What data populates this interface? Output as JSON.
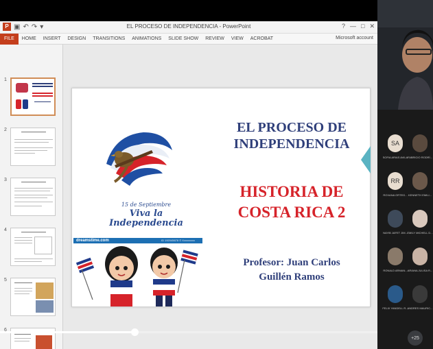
{
  "app": {
    "window_title": "EL PROCESO DE INDEPENDENCIA - PowerPoint",
    "account_label": "Microsoft account",
    "app_badge": "P"
  },
  "ribbon": {
    "tabs": [
      "FILE",
      "HOME",
      "INSERT",
      "DESIGN",
      "TRANSITIONS",
      "ANIMATIONS",
      "SLIDE SHOW",
      "REVIEW",
      "VIEW",
      "ACROBAT"
    ]
  },
  "thumbnails": {
    "numbers": [
      "1",
      "2",
      "3",
      "4",
      "5",
      "6"
    ],
    "active_index": 0
  },
  "slide": {
    "title": "EL PROCESO DE INDEPENDENCIA",
    "subtitle": "HISTORIA DE COSTA RICA 2",
    "professor": "Profesor: Juan Carlos Guillén Ramos",
    "emblem_date": "15 de Septiembre",
    "emblem_line2": "Viva la",
    "emblem_line3": "Independencia",
    "stock_left": "dreamstime.com",
    "stock_right": "ID 192045678 © Xxxxxxxxx"
  },
  "video": {
    "progress": 0.31
  },
  "participants": [
    {
      "name": "SOFIA ARIAS AVILA",
      "initials": "SA",
      "bg": "#e8ddd0"
    },
    {
      "name": "FABRICIO RODRÍ...",
      "initials": "",
      "bg": "#5a4a3e"
    },
    {
      "name": "ROXANA ORTEG...",
      "initials": "RR",
      "bg": "#e8ddd0"
    },
    {
      "name": "KENNETH EMILI...",
      "initials": "",
      "bg": "#6b584a"
    },
    {
      "name": "NAYIB JAFET JIM...",
      "initials": "",
      "bg": "#3e4a5a"
    },
    {
      "name": "EMILY MICHELL D...",
      "initials": "",
      "bg": "#d9c8bd"
    },
    {
      "name": "RONALD ARMAN...",
      "initials": "",
      "bg": "#8a7a6a"
    },
    {
      "name": "ARIANA JULISA R...",
      "initials": "",
      "bg": "#c9b3a5"
    },
    {
      "name": "FELIX YANDELL R...",
      "initials": "",
      "bg": "#2a5a8a"
    },
    {
      "name": "ANDRES MAURIC...",
      "initials": "",
      "bg": "#3a3a3a"
    }
  ],
  "more_count": "+25",
  "colors": {
    "file_tab": "#c43e1c",
    "title_blue": "#2f3f7a",
    "subtitle_red": "#d6232a",
    "accent_teal": "#5ab3c2"
  }
}
